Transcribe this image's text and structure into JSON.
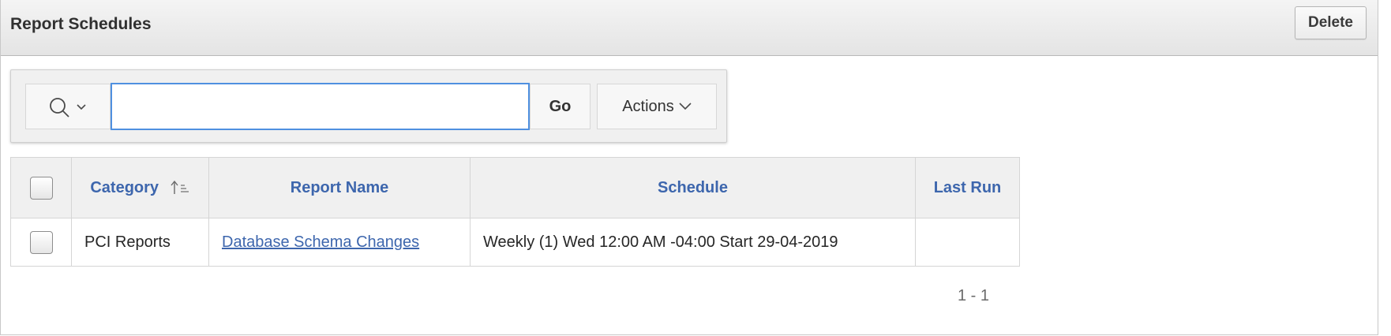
{
  "region": {
    "title": "Report Schedules",
    "delete_label": "Delete"
  },
  "toolbar": {
    "search_icon": "search-icon",
    "chevron_icon": "chevron-down-icon",
    "search_value": "",
    "go_label": "Go",
    "actions_label": "Actions"
  },
  "table": {
    "headers": {
      "category": "Category",
      "report_name": "Report Name",
      "schedule": "Schedule",
      "last_run": "Last Run"
    },
    "sort_icon": "sort-ascending-icon",
    "rows": [
      {
        "category": "PCI Reports",
        "report_name": "Database Schema Changes",
        "schedule": "Weekly (1) Wed 12:00 AM -04:00 Start 29-04-2019",
        "last_run": ""
      }
    ]
  },
  "pagination": {
    "range": "1 - 1"
  },
  "colors": {
    "link": "#3d66ad",
    "focus_border": "#4f90e0"
  }
}
